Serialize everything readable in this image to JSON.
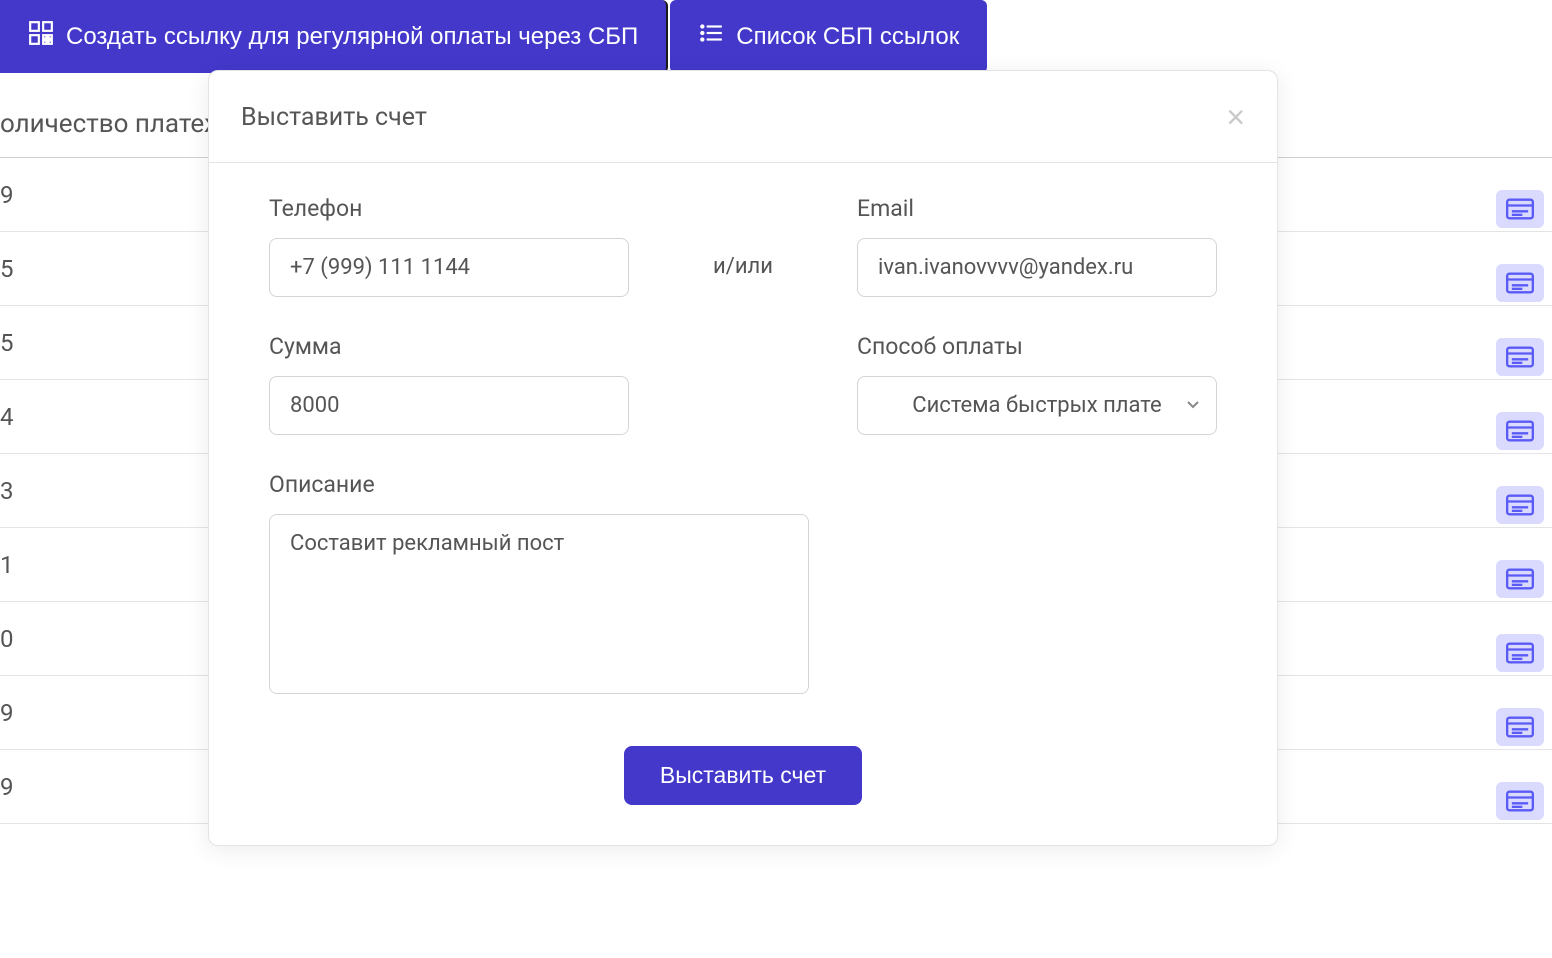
{
  "toolbar": {
    "create_link_label": "Создать ссылку для регулярной оплаты через СБП",
    "list_links_label": "Список СБП ссылок"
  },
  "table": {
    "header_partial": "оличество платеж",
    "rows": [
      "9",
      "5",
      "5",
      "4",
      "3",
      "1",
      "0",
      "9",
      "9"
    ]
  },
  "modal": {
    "title": "Выставить счет",
    "phone_label": "Телефон",
    "phone_value": "+7 (999) 111 1144",
    "andor": "и/или",
    "email_label": "Email",
    "email_value": "ivan.ivanovvvv@yandex.ru",
    "amount_label": "Сумма",
    "amount_value": "8000",
    "method_label": "Способ оплаты",
    "method_value": "Система быстрых платежей",
    "method_display": "Система быстрых плате",
    "description_label": "Описание",
    "description_value": "Составит рекламный пост",
    "submit_label": "Выставить счет"
  },
  "icons": {
    "qr": "qr-icon",
    "list": "list-icon",
    "close": "close-icon",
    "chevron_down": "chevron-down-icon",
    "row_card": "card-icon"
  }
}
